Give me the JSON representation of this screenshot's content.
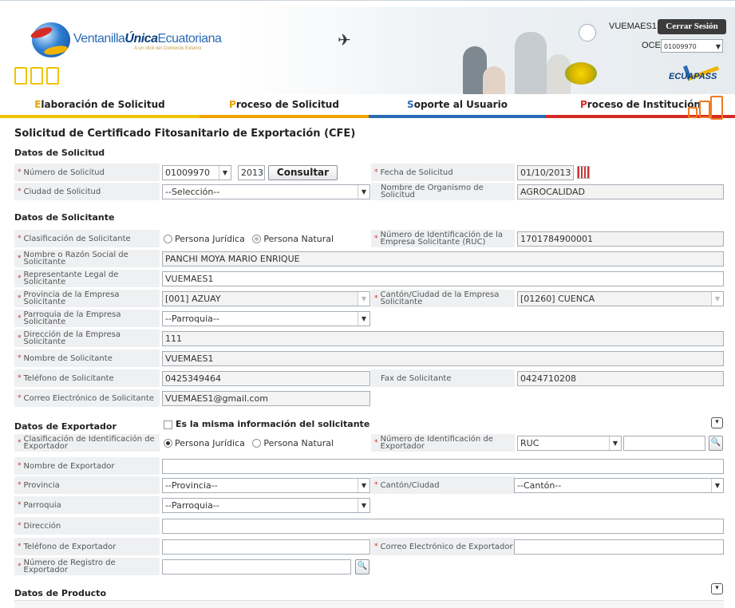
{
  "header": {
    "logo_main": "Ventanilla",
    "logo_bold": "Única",
    "logo_end": "Ecuatoriana",
    "logo_sub": "A un click del Comercio Exterior",
    "user": "VUEMAES1",
    "logout": "Cerrar Sesión",
    "oce_label": "OCE",
    "oce_value": "01009970",
    "brand": "ECUAPASS"
  },
  "nav": {
    "items": [
      {
        "first": "E",
        "rest": "laboración de Solicitud"
      },
      {
        "first": "P",
        "rest": "roceso de Solicitud"
      },
      {
        "first": "S",
        "rest": "oporte al Usuario"
      },
      {
        "first": "P",
        "rest": "roceso de Institución"
      }
    ]
  },
  "title": "Solicitud de Certificado Fitosanitario de Exportación (CFE)",
  "sections": {
    "solicitud": "Datos de Solicitud",
    "solicitante": "Datos de Solicitante",
    "exportador": "Datos de Exportador",
    "exportador_check": "Es la misma información del solicitante",
    "producto": "Datos de Producto"
  },
  "solicitud": {
    "numero_label": "Número de Solicitud",
    "numero_value": "01009970",
    "year": "2013",
    "consultar": "Consultar",
    "fecha_label": "Fecha de Solicitud",
    "fecha_value": "01/10/2013",
    "ciudad_label": "Ciudad de Solicitud",
    "ciudad_value": "--Selección--",
    "organismo_label": "Nombre de Organismo de Solicitud",
    "organismo_value": "AGROCALIDAD"
  },
  "solicitante": {
    "clasif_label": "Clasificación de Solicitante",
    "opt_juridica": "Persona Jurídica",
    "opt_natural": "Persona Natural",
    "ruc_label": "Número de Identificación de la Empresa Solicitante (RUC)",
    "ruc_value": "1701784900001",
    "razon_label": "Nombre o Razón Social de Solicitante",
    "razon_value": "PANCHI MOYA MARIO ENRIQUE",
    "rep_label": "Representante Legal de Solicitante",
    "rep_value": "VUEMAES1",
    "prov_label": "Provincia de la Empresa Solicitante",
    "prov_value": "[001] AZUAY",
    "canton_label": "Cantón/Ciudad de la Empresa Solicitante",
    "canton_value": "[01260] CUENCA",
    "parr_label": "Parroquia de la Empresa Solicitante",
    "parr_value": "--Parroquia--",
    "dir_label": "Dirección de la Empresa Solicitante",
    "dir_value": "111",
    "nombre_label": "Nombre de Solicitante",
    "nombre_value": "VUEMAES1",
    "tel_label": "Teléfono de Solicitante",
    "tel_value": "0425349464",
    "fax_label": "Fax de Solicitante",
    "fax_value": "0424710208",
    "correo_label": "Correo Electrónico de Solicitante",
    "correo_value": "VUEMAES1@gmail.com"
  },
  "exportador": {
    "clasif_label": "Clasificación de Identificación de Exportador",
    "opt_juridica": "Persona Jurídica",
    "opt_natural": "Persona Natural",
    "num_label": "Número de Identificación de Exportador",
    "num_type": "RUC",
    "nombre_label": "Nombre de Exportador",
    "prov_label": "Provincia",
    "prov_value": "--Provincia--",
    "canton_label": "Cantón/Ciudad",
    "canton_value": "--Cantón--",
    "parr_label": "Parroquia",
    "parr_value": "--Parroquia--",
    "dir_label": "Dirección",
    "tel_label": "Teléfono de Exportador",
    "correo_label": "Correo Electrónico de Exportador",
    "registro_label": "Número de Registro de Exportador"
  },
  "colors": {
    "required": "#d62b25",
    "label_bg": "#eef0f2",
    "nav_yellow": "#f0c400",
    "nav_orange": "#f0a400",
    "nav_blue": "#2a6bb5",
    "nav_red": "#d62b25"
  }
}
